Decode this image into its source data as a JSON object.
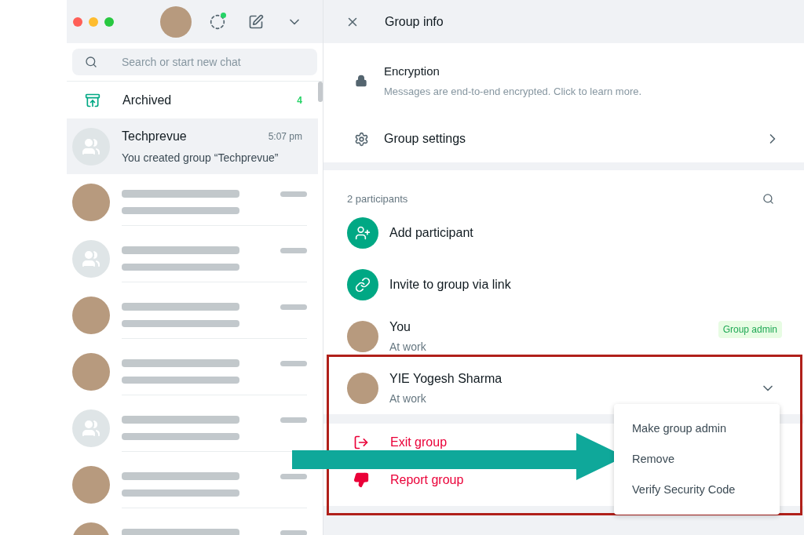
{
  "window_controls": [
    {
      "color": "#ff5f57"
    },
    {
      "color": "#febc2e"
    },
    {
      "color": "#28c840"
    }
  ],
  "sidebar": {
    "search": {
      "placeholder": "Search or start new chat"
    },
    "archived": {
      "label": "Archived",
      "count": "4"
    },
    "chats": [
      {
        "kind": "chat",
        "group_avatar": true,
        "name": "Techprevue",
        "time": "5:07 pm",
        "preview": "You created group “Techprevue”",
        "selected": true
      },
      {
        "kind": "blurred",
        "group_avatar": false,
        "selected": false
      },
      {
        "kind": "blurred",
        "group_avatar": true,
        "selected": false
      },
      {
        "kind": "blurred",
        "group_avatar": false,
        "selected": false
      },
      {
        "kind": "blurred",
        "group_avatar": false,
        "selected": false
      },
      {
        "kind": "blurred",
        "group_avatar": true,
        "selected": false
      },
      {
        "kind": "blurred",
        "group_avatar": false,
        "selected": false
      },
      {
        "kind": "blurred",
        "group_avatar": false,
        "selected": false
      }
    ]
  },
  "group_info": {
    "title": "Group info",
    "encryption": {
      "title": "Encryption",
      "subtitle": "Messages are end-to-end encrypted. Click to learn more."
    },
    "settings": {
      "label": "Group settings"
    },
    "participants": {
      "count_label": "2 participants",
      "actions": [
        {
          "kind": "add",
          "label": "Add participant"
        },
        {
          "kind": "link",
          "label": "Invite to group via link"
        }
      ],
      "members": [
        {
          "name": "You",
          "status": "At work",
          "badge": "Group admin",
          "chevron": false
        },
        {
          "name": "YIE Yogesh Sharma",
          "status": "At work",
          "chevron": true,
          "menu": [
            "Make group admin",
            "Remove",
            "Verify Security Code"
          ]
        }
      ]
    },
    "danger_actions": [
      {
        "kind": "exit",
        "label": "Exit group"
      },
      {
        "kind": "report",
        "label": "Report group"
      }
    ]
  },
  "annotation": {
    "highlight_box": true,
    "arrow": true
  }
}
